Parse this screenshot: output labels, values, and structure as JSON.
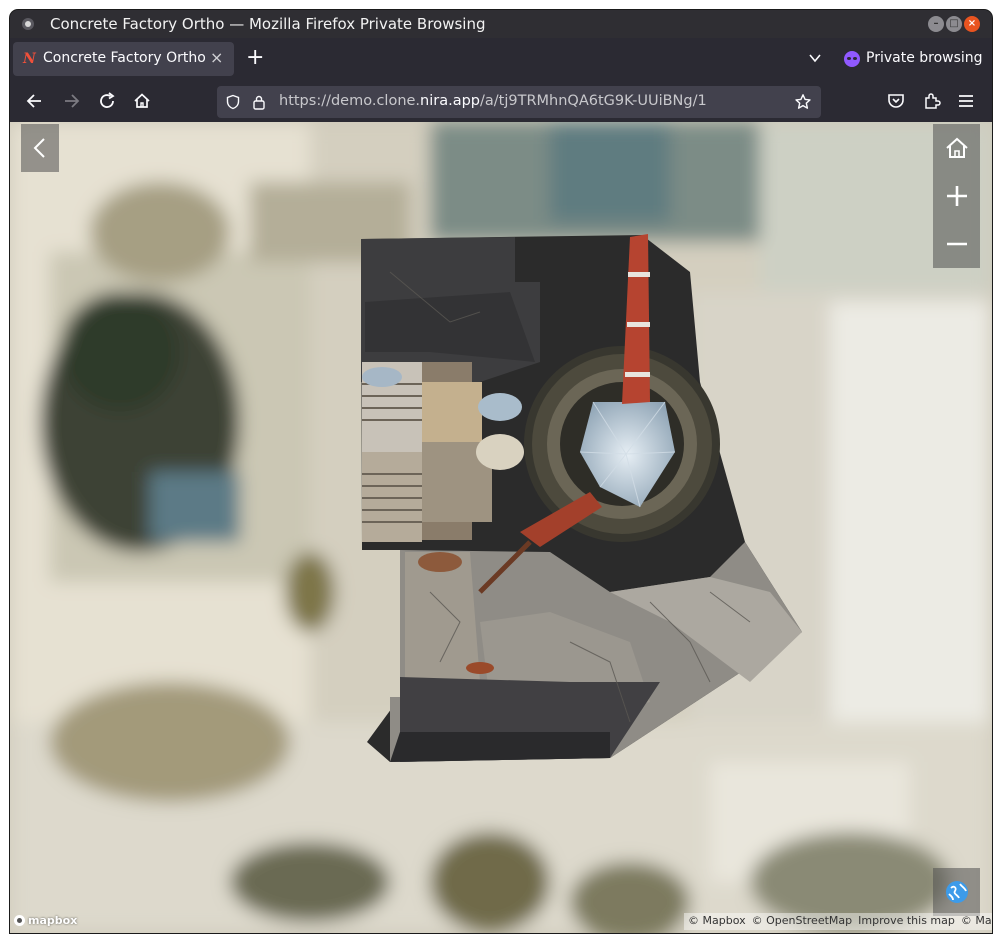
{
  "window": {
    "title": "Concrete Factory Ortho — Mozilla Firefox Private Browsing"
  },
  "tabs": [
    {
      "label": "Concrete Factory Ortho",
      "favicon": "N"
    }
  ],
  "tabbar": {
    "new_tab": "+",
    "private_label": "Private browsing"
  },
  "navbar": {
    "url_prefix": "https://demo.clone.",
    "url_domain": "nira.app",
    "url_path": "/a/tj9TRMhnQA6tG9K-UUiBNg/1"
  },
  "map": {
    "logo_text": "mapbox",
    "attribution": [
      "© Mapbox",
      "© OpenStreetMap",
      "Improve this map",
      "© Maxar"
    ],
    "controls": {
      "back": "back-chevron-icon",
      "home": "home-icon",
      "zoom_in": "plus-icon",
      "zoom_out": "minus-icon",
      "globe": "globe-icon"
    }
  },
  "colors": {
    "chrome_bg": "#2b2a33",
    "tab_active": "#42414d",
    "private_accent": "#9059ff",
    "globe_accent": "#3d9be9"
  }
}
